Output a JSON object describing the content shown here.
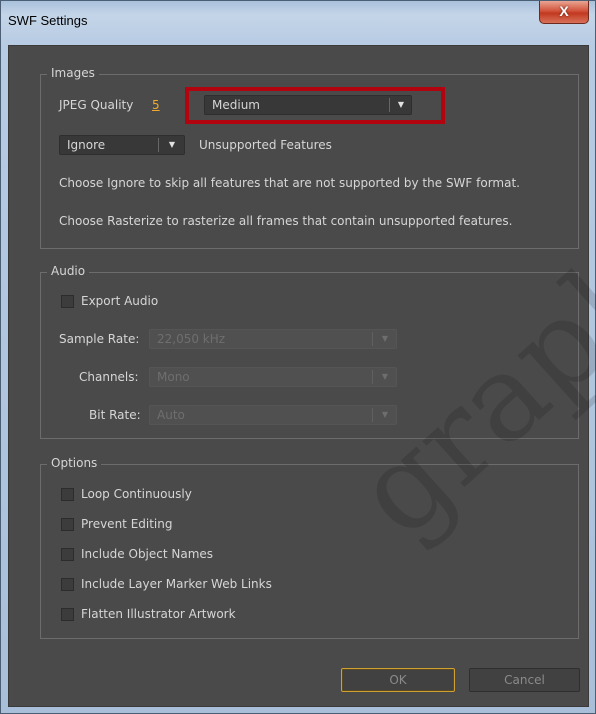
{
  "window": {
    "title": "SWF Settings",
    "close_glyph": "X"
  },
  "images": {
    "group_label": "Images",
    "jpeg_quality_label": "JPEG Quality",
    "jpeg_quality_value": "5",
    "quality_select_value": "Medium",
    "unsupported_select_value": "Ignore",
    "unsupported_label": "Unsupported Features",
    "help_ignore": "Choose Ignore to skip all features that are not supported by the SWF format.",
    "help_rasterize": "Choose Rasterize to rasterize all frames that contain unsupported features."
  },
  "audio": {
    "group_label": "Audio",
    "export_audio_label": "Export Audio",
    "export_audio_checked": false,
    "sample_rate_label": "Sample Rate:",
    "sample_rate_value": "22,050 kHz",
    "channels_label": "Channels:",
    "channels_value": "Mono",
    "bit_rate_label": "Bit Rate:",
    "bit_rate_value": "Auto"
  },
  "options": {
    "group_label": "Options",
    "items": [
      {
        "label": "Loop Continuously",
        "checked": false
      },
      {
        "label": "Prevent Editing",
        "checked": false
      },
      {
        "label": "Include Object Names",
        "checked": false
      },
      {
        "label": "Include Layer Marker Web Links",
        "checked": false
      },
      {
        "label": "Flatten Illustrator Artwork",
        "checked": false
      }
    ]
  },
  "buttons": {
    "ok_label": "OK",
    "cancel_label": "Cancel"
  },
  "icons": {
    "dropdown_arrow": "▼"
  },
  "colors": {
    "accent_orange": "#f0a930",
    "highlight_red": "#b1040e",
    "panel_bg": "#4a4a4a"
  },
  "watermark_text": "graphic"
}
